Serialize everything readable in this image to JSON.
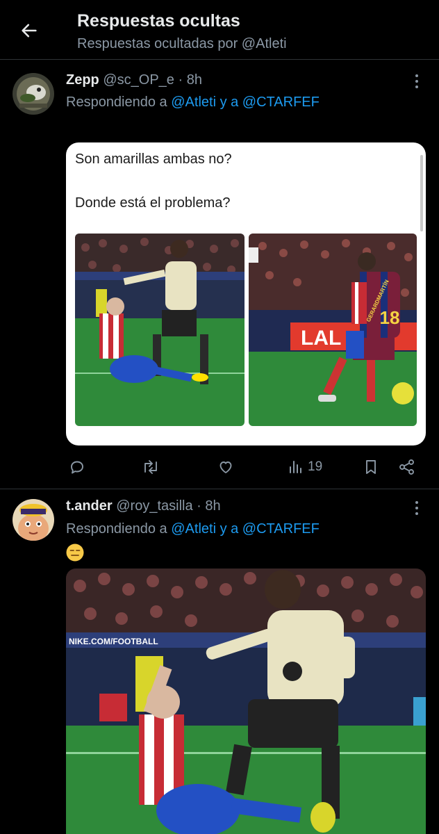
{
  "header": {
    "title": "Respuestas ocultas",
    "subtitle": "Respuestas ocultadas por @Atleti"
  },
  "tweets": [
    {
      "name": "Zepp",
      "handle": "@sc_OP_e",
      "time": "· 8h",
      "reply_prefix": "Respondiendo a",
      "reply_target": "@Atleti y a @CTARFEF",
      "quote": {
        "line1": "Son amarillas ambas no?",
        "line2": "Donde está el problema?"
      },
      "actions": {
        "views": "19"
      }
    },
    {
      "name": "t.ander",
      "handle": "@roy_tasilla",
      "time": "· 8h",
      "reply_prefix": "Respondiendo a",
      "reply_target": "@Atleti y a @CTARFEF"
    }
  ],
  "media": {
    "ad_board_left": "NIKE.COM/FOOTBALL",
    "jersey_number": "18",
    "jersey_name": "GERARDMARTÍN",
    "ad_board_right": "LAL"
  },
  "colors": {
    "background": "#000000",
    "text_primary": "#e7e9ea",
    "text_secondary": "#8b98a5",
    "link": "#1d9bf0",
    "divider": "#2f3336"
  },
  "icons": [
    "back-arrow-icon",
    "more-dots-icon",
    "reply-icon",
    "retweet-icon",
    "like-icon",
    "views-icon",
    "bookmark-icon",
    "share-icon",
    "expressionless-emoji-icon"
  ]
}
